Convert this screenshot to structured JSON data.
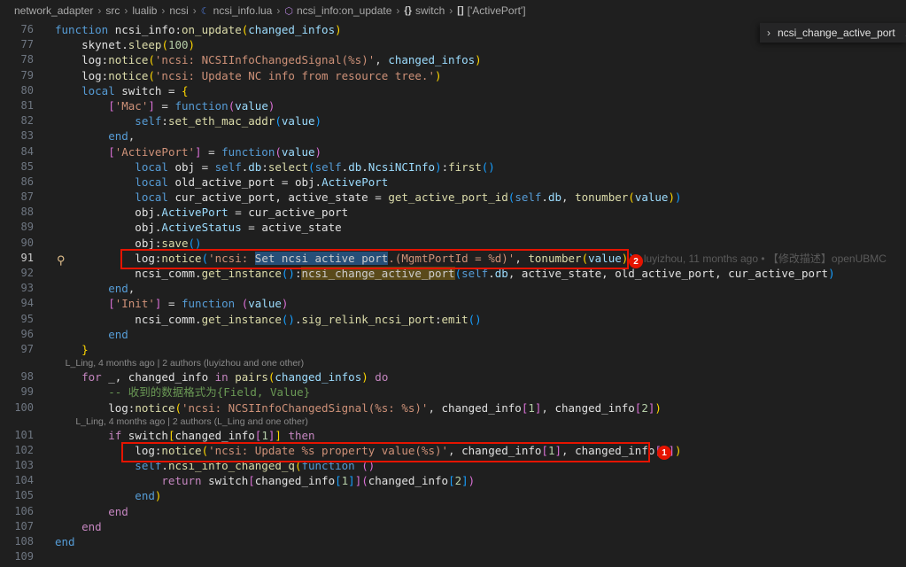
{
  "breadcrumb": {
    "items": [
      "network_adapter",
      "src",
      "lualib",
      "ncsi",
      "ncsi_info.lua",
      "ncsi_info:on_update",
      "switch",
      "['ActivePort']"
    ]
  },
  "sticky_panel": {
    "label": "ncsi_change_active_port",
    "extra": "A"
  },
  "annotations": {
    "badge1": "1",
    "badge2": "2"
  },
  "current_line": "91",
  "lines": [
    {
      "n": "76",
      "tokens": [
        [
          "kw2",
          "function "
        ],
        [
          "var",
          "ncsi_info:"
        ],
        [
          "fn",
          "on_update"
        ],
        [
          "br1",
          "("
        ],
        [
          "prop",
          "changed_infos"
        ],
        [
          "br1",
          ")"
        ]
      ]
    },
    {
      "n": "77",
      "tokens": [
        [
          "var",
          "    skynet."
        ],
        [
          "fn",
          "sleep"
        ],
        [
          "br1",
          "("
        ],
        [
          "num",
          "100"
        ],
        [
          "br1",
          ")"
        ]
      ]
    },
    {
      "n": "78",
      "tokens": [
        [
          "var",
          "    log:"
        ],
        [
          "fn",
          "notice"
        ],
        [
          "br1",
          "("
        ],
        [
          "str",
          "'ncsi: NCSIInfoChangedSignal(%s)'"
        ],
        [
          "pun",
          ", "
        ],
        [
          "prop",
          "changed_infos"
        ],
        [
          "br1",
          ")"
        ]
      ]
    },
    {
      "n": "79",
      "tokens": [
        [
          "var",
          "    log:"
        ],
        [
          "fn",
          "notice"
        ],
        [
          "br1",
          "("
        ],
        [
          "str",
          "'ncsi: Update NC info from resource tree.'"
        ],
        [
          "br1",
          ")"
        ]
      ]
    },
    {
      "n": "80",
      "tokens": [
        [
          "kw2",
          "    local "
        ],
        [
          "var",
          "switch "
        ],
        [
          "pun",
          "= "
        ],
        [
          "br1",
          "{"
        ]
      ]
    },
    {
      "n": "81",
      "tokens": [
        [
          "br2",
          "        ["
        ],
        [
          "str",
          "'Mac'"
        ],
        [
          "br2",
          "]"
        ],
        [
          "pun",
          " = "
        ],
        [
          "kw2",
          "function"
        ],
        [
          "br2",
          "("
        ],
        [
          "prop",
          "value"
        ],
        [
          "br2",
          ")"
        ]
      ]
    },
    {
      "n": "82",
      "tokens": [
        [
          "kw2",
          "            self"
        ],
        [
          "var",
          ":"
        ],
        [
          "fn",
          "set_eth_mac_addr"
        ],
        [
          "br3",
          "("
        ],
        [
          "prop",
          "value"
        ],
        [
          "br3",
          ")"
        ]
      ]
    },
    {
      "n": "83",
      "tokens": [
        [
          "kw2",
          "        end"
        ],
        [
          "pun",
          ","
        ]
      ]
    },
    {
      "n": "84",
      "tokens": [
        [
          "br2",
          "        ["
        ],
        [
          "str",
          "'ActivePort'"
        ],
        [
          "br2",
          "]"
        ],
        [
          "pun",
          " = "
        ],
        [
          "kw2",
          "function"
        ],
        [
          "br2",
          "("
        ],
        [
          "prop",
          "value"
        ],
        [
          "br2",
          ")"
        ]
      ]
    },
    {
      "n": "85",
      "tokens": [
        [
          "kw2",
          "            local "
        ],
        [
          "var",
          "obj "
        ],
        [
          "pun",
          "= "
        ],
        [
          "kw2",
          "self"
        ],
        [
          "var",
          "."
        ],
        [
          "prop",
          "db"
        ],
        [
          "var",
          ":"
        ],
        [
          "fn",
          "select"
        ],
        [
          "br3",
          "("
        ],
        [
          "kw2",
          "self"
        ],
        [
          "var",
          "."
        ],
        [
          "prop",
          "db"
        ],
        [
          "var",
          "."
        ],
        [
          "prop",
          "NcsiNCInfo"
        ],
        [
          "br3",
          ")"
        ],
        [
          "var",
          ":"
        ],
        [
          "fn",
          "first"
        ],
        [
          "br3",
          "()"
        ]
      ]
    },
    {
      "n": "86",
      "tokens": [
        [
          "kw2",
          "            local "
        ],
        [
          "var",
          "old_active_port "
        ],
        [
          "pun",
          "= "
        ],
        [
          "var",
          "obj."
        ],
        [
          "prop",
          "ActivePort"
        ]
      ]
    },
    {
      "n": "87",
      "tokens": [
        [
          "kw2",
          "            local "
        ],
        [
          "var",
          "cur_active_port, active_state "
        ],
        [
          "pun",
          "= "
        ],
        [
          "fn",
          "get_active_port_id"
        ],
        [
          "br3",
          "("
        ],
        [
          "kw2",
          "self"
        ],
        [
          "var",
          "."
        ],
        [
          "prop",
          "db"
        ],
        [
          "pun",
          ", "
        ],
        [
          "fn",
          "tonumber"
        ],
        [
          "br1",
          "("
        ],
        [
          "prop",
          "value"
        ],
        [
          "br1",
          ")"
        ],
        [
          "br3",
          ")"
        ]
      ]
    },
    {
      "n": "88",
      "tokens": [
        [
          "var",
          "            obj."
        ],
        [
          "prop",
          "ActivePort"
        ],
        [
          "pun",
          " = "
        ],
        [
          "var",
          "cur_active_port"
        ]
      ]
    },
    {
      "n": "89",
      "tokens": [
        [
          "var",
          "            obj."
        ],
        [
          "prop",
          "ActiveStatus"
        ],
        [
          "pun",
          " = "
        ],
        [
          "var",
          "active_state"
        ]
      ]
    },
    {
      "n": "90",
      "tokens": [
        [
          "var",
          "            obj:"
        ],
        [
          "fn",
          "save"
        ],
        [
          "br3",
          "()"
        ]
      ]
    },
    {
      "n": "91",
      "tokens": [
        [
          "var",
          "            log:"
        ],
        [
          "fn",
          "notice"
        ],
        [
          "br3",
          "("
        ],
        [
          "str",
          "'ncsi: "
        ],
        [
          "sel",
          "Set ncsi active port"
        ],
        [
          "str",
          ".(MgmtPortId = %d)'"
        ],
        [
          "pun",
          ", "
        ],
        [
          "fn",
          "tonumber"
        ],
        [
          "br1",
          "("
        ],
        [
          "prop",
          "value"
        ],
        [
          "br1",
          ")"
        ],
        [
          "br3",
          ")"
        ],
        [
          "blame",
          "   luyizhou, 11 months ago • 【修改描述】openUBMC"
        ]
      ]
    },
    {
      "n": "92",
      "tokens": [
        [
          "var",
          "            ncsi_comm."
        ],
        [
          "fn",
          "get_instance"
        ],
        [
          "br3",
          "()"
        ],
        [
          "var",
          ":"
        ],
        [
          "hl",
          "ncsi_change_active_port"
        ],
        [
          "br3",
          "("
        ],
        [
          "kw2",
          "self"
        ],
        [
          "var",
          "."
        ],
        [
          "prop",
          "db"
        ],
        [
          "pun",
          ", "
        ],
        [
          "var",
          "active_state, old_active_port, cur_active_port"
        ],
        [
          "br3",
          ")"
        ]
      ]
    },
    {
      "n": "93",
      "tokens": [
        [
          "kw2",
          "        end"
        ],
        [
          "pun",
          ","
        ]
      ]
    },
    {
      "n": "94",
      "tokens": [
        [
          "br2",
          "        ["
        ],
        [
          "str",
          "'Init'"
        ],
        [
          "br2",
          "]"
        ],
        [
          "pun",
          " = "
        ],
        [
          "kw2",
          "function "
        ],
        [
          "br2",
          "("
        ],
        [
          "prop",
          "value"
        ],
        [
          "br2",
          ")"
        ]
      ]
    },
    {
      "n": "95",
      "tokens": [
        [
          "var",
          "            ncsi_comm."
        ],
        [
          "fn",
          "get_instance"
        ],
        [
          "br3",
          "()"
        ],
        [
          "var",
          "."
        ],
        [
          "fn",
          "sig_relink_ncsi_port"
        ],
        [
          "var",
          ":"
        ],
        [
          "fn",
          "emit"
        ],
        [
          "br3",
          "()"
        ]
      ]
    },
    {
      "n": "96",
      "tokens": [
        [
          "kw2",
          "        end"
        ]
      ]
    },
    {
      "n": "97",
      "tokens": [
        [
          "br1",
          "    }"
        ]
      ]
    },
    {
      "n": "",
      "lens": "    L_Ling, 4 months ago | 2 authors (luyizhou and one other)"
    },
    {
      "n": "98",
      "tokens": [
        [
          "kw",
          "    for "
        ],
        [
          "var",
          "_, changed_info "
        ],
        [
          "kw",
          "in "
        ],
        [
          "fn",
          "pairs"
        ],
        [
          "br1",
          "("
        ],
        [
          "prop",
          "changed_infos"
        ],
        [
          "br1",
          ")"
        ],
        [
          "kw",
          " do"
        ]
      ]
    },
    {
      "n": "99",
      "tokens": [
        [
          "cmt",
          "        -- 收到的数据格式为{Field, Value}"
        ]
      ]
    },
    {
      "n": "100",
      "tokens": [
        [
          "var",
          "        log:"
        ],
        [
          "fn",
          "notice"
        ],
        [
          "br1",
          "("
        ],
        [
          "str",
          "'ncsi: NCSIInfoChangedSignal(%s: %s)'"
        ],
        [
          "pun",
          ", "
        ],
        [
          "var",
          "changed_info"
        ],
        [
          "br2",
          "["
        ],
        [
          "num",
          "1"
        ],
        [
          "br2",
          "]"
        ],
        [
          "pun",
          ", "
        ],
        [
          "var",
          "changed_info"
        ],
        [
          "br2",
          "["
        ],
        [
          "num",
          "2"
        ],
        [
          "br2",
          "]"
        ],
        [
          "br1",
          ")"
        ]
      ]
    },
    {
      "n": "",
      "lens": "        L_Ling, 4 months ago | 2 authors (L_Ling and one other)"
    },
    {
      "n": "101",
      "tokens": [
        [
          "kw",
          "        if "
        ],
        [
          "var",
          "switch"
        ],
        [
          "br1",
          "["
        ],
        [
          "var",
          "changed_info"
        ],
        [
          "br2",
          "["
        ],
        [
          "num",
          "1"
        ],
        [
          "br2",
          "]"
        ],
        [
          "br1",
          "]"
        ],
        [
          "kw",
          " then"
        ]
      ]
    },
    {
      "n": "102",
      "tokens": [
        [
          "var",
          "            log:"
        ],
        [
          "fn",
          "notice"
        ],
        [
          "br1",
          "("
        ],
        [
          "str",
          "'ncsi: Update %s property value(%s)'"
        ],
        [
          "pun",
          ", "
        ],
        [
          "var",
          "changed_info"
        ],
        [
          "br2",
          "["
        ],
        [
          "num",
          "1"
        ],
        [
          "br2",
          "]"
        ],
        [
          "pun",
          ", "
        ],
        [
          "var",
          "changed_info"
        ],
        [
          "br2",
          "["
        ],
        [
          "num",
          "2"
        ],
        [
          "br2",
          "]"
        ],
        [
          "br1",
          ")"
        ]
      ]
    },
    {
      "n": "103",
      "tokens": [
        [
          "kw2",
          "            self"
        ],
        [
          "var",
          "."
        ],
        [
          "fn",
          "ncsi_info_changed_q"
        ],
        [
          "br1",
          "("
        ],
        [
          "kw2",
          "function "
        ],
        [
          "br2",
          "()"
        ]
      ]
    },
    {
      "n": "104",
      "tokens": [
        [
          "kw",
          "                return "
        ],
        [
          "var",
          "switch"
        ],
        [
          "br2",
          "["
        ],
        [
          "var",
          "changed_info"
        ],
        [
          "br3",
          "["
        ],
        [
          "num",
          "1"
        ],
        [
          "br3",
          "]"
        ],
        [
          "br2",
          "]"
        ],
        [
          "br2",
          "("
        ],
        [
          "var",
          "changed_info"
        ],
        [
          "br3",
          "["
        ],
        [
          "num",
          "2"
        ],
        [
          "br3",
          "]"
        ],
        [
          "br2",
          ")"
        ]
      ]
    },
    {
      "n": "105",
      "tokens": [
        [
          "kw2",
          "            end"
        ],
        [
          "br1",
          ")"
        ]
      ]
    },
    {
      "n": "106",
      "tokens": [
        [
          "kw",
          "        end"
        ]
      ]
    },
    {
      "n": "107",
      "tokens": [
        [
          "kw",
          "    end"
        ]
      ]
    },
    {
      "n": "108",
      "tokens": [
        [
          "kw2",
          "end"
        ]
      ]
    },
    {
      "n": "109",
      "tokens": []
    }
  ]
}
